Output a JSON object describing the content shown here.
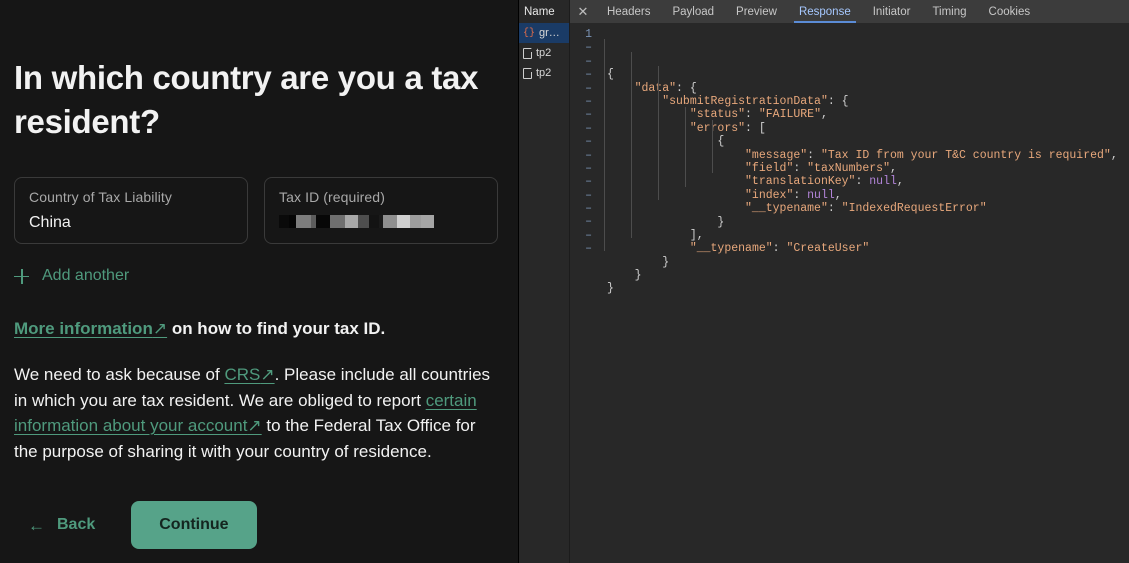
{
  "app": {
    "title": "In which country are you a tax resident?",
    "fields": [
      {
        "label": "Country of Tax Liability",
        "value": "China",
        "redacted": false
      },
      {
        "label": "Tax ID (required)",
        "value": "",
        "redacted": true
      }
    ],
    "add_another_label": "Add another",
    "info_line": {
      "link_text": "More information",
      "link_arrow": "↗",
      "rest": " on how to find your tax ID."
    },
    "body": {
      "part1": "We need to ask because of ",
      "link1": "CRS",
      "arrow1": "↗",
      "part2": ". Please include all countries in which you are tax resident. We are obliged to report ",
      "link2": "certain information about your account",
      "arrow2": "↗",
      "part3": " to the Federal Tax Office for the purpose of sharing it with your country of residence."
    },
    "back_label": "Back",
    "back_arrow": "←",
    "continue_label": "Continue",
    "accent_color": "#56a389",
    "link_color": "#4f9a7d"
  },
  "devtools": {
    "name_column_header": "Name",
    "close_icon": "✕",
    "tabs": [
      {
        "label": "Headers",
        "active": false
      },
      {
        "label": "Payload",
        "active": false
      },
      {
        "label": "Preview",
        "active": false
      },
      {
        "label": "Response",
        "active": true
      },
      {
        "label": "Initiator",
        "active": false
      },
      {
        "label": "Timing",
        "active": false
      },
      {
        "label": "Cookies",
        "active": false
      }
    ],
    "active_tab_color": "#a6c8ff",
    "requests": [
      {
        "name": "gr…",
        "icon": "graphql-icon",
        "selected": true
      },
      {
        "name": "tp2",
        "icon": "document-icon",
        "selected": false
      },
      {
        "name": "tp2",
        "icon": "document-icon",
        "selected": false
      }
    ],
    "response": {
      "first_line_number": "1",
      "wrapped_marker": "–",
      "lines": [
        "{",
        "    \"data\": {",
        "        \"submitRegistrationData\": {",
        "            \"status\": \"FAILURE\",",
        "            \"errors\": [",
        "                {",
        "                    \"message\": \"Tax ID from your T&C country is required\",",
        "                    \"field\": \"taxNumbers\",",
        "                    \"translationKey\": null,",
        "                    \"index\": null,",
        "                    \"__typename\": \"IndexedRequestError\"",
        "                }",
        "            ],",
        "            \"__typename\": \"CreateUser\"",
        "        }",
        "    }",
        "}"
      ]
    }
  }
}
